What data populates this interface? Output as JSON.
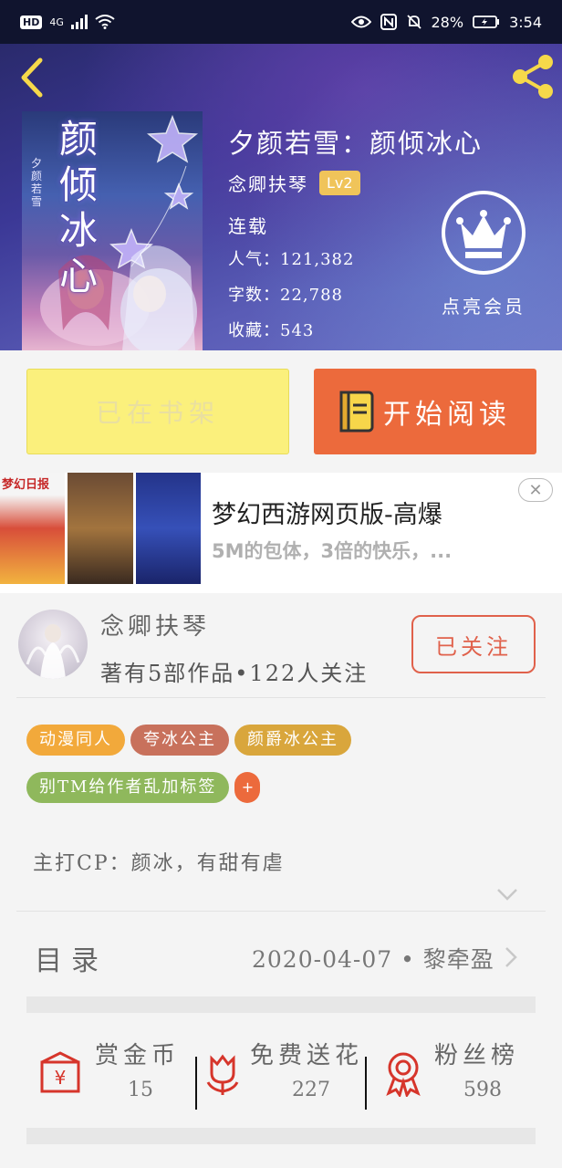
{
  "status_bar": {
    "network": "4G",
    "hd_label": "HD",
    "battery": "28%",
    "time": "3:54"
  },
  "book": {
    "title": "夕颜若雪：颜倾冰心",
    "author": "念卿扶琴",
    "level": "Lv2",
    "status": "连载",
    "popularity": "人气：121,382",
    "word_count": "字数：22,788",
    "favorites": "收藏：543",
    "cover_title_chars": [
      "颜",
      "倾",
      "冰",
      "心"
    ],
    "cover_subtitle": "夕颜若雪"
  },
  "vip": {
    "label": "点亮会员"
  },
  "actions": {
    "shelf_label": "已在书架",
    "read_label": "开始阅读"
  },
  "ad": {
    "title": "梦幻西游网页版-高爆",
    "description": "5M的包体，3倍的快乐，...",
    "thumb_tag": "梦幻日报",
    "close": "✕"
  },
  "author_card": {
    "name": "念卿扶琴",
    "subtitle": "著有5部作品•122人关注",
    "follow_label": "已关注"
  },
  "tags": [
    {
      "label": "动漫同人",
      "color": "#f2a93b"
    },
    {
      "label": "夸冰公主",
      "color": "#c8715c"
    },
    {
      "label": "颜爵冰公主",
      "color": "#d9a63c"
    },
    {
      "label": "别TM给作者乱加标签",
      "color": "#8fb85c"
    }
  ],
  "tag_add": "+",
  "intro": "主打CP：颜冰，有甜有虐",
  "toc": {
    "label": "目录",
    "latest": "2020-04-07 • 黎牵盈"
  },
  "stats": [
    {
      "label": "赏金币",
      "value": "15"
    },
    {
      "label": "免费送花",
      "value": "227"
    },
    {
      "label": "粉丝榜",
      "value": "598"
    }
  ],
  "colors": {
    "accent": "#ec6a3c",
    "shelf_button": "#fbf07c",
    "follow": "#e0614b",
    "icon_red": "#d6352b"
  }
}
